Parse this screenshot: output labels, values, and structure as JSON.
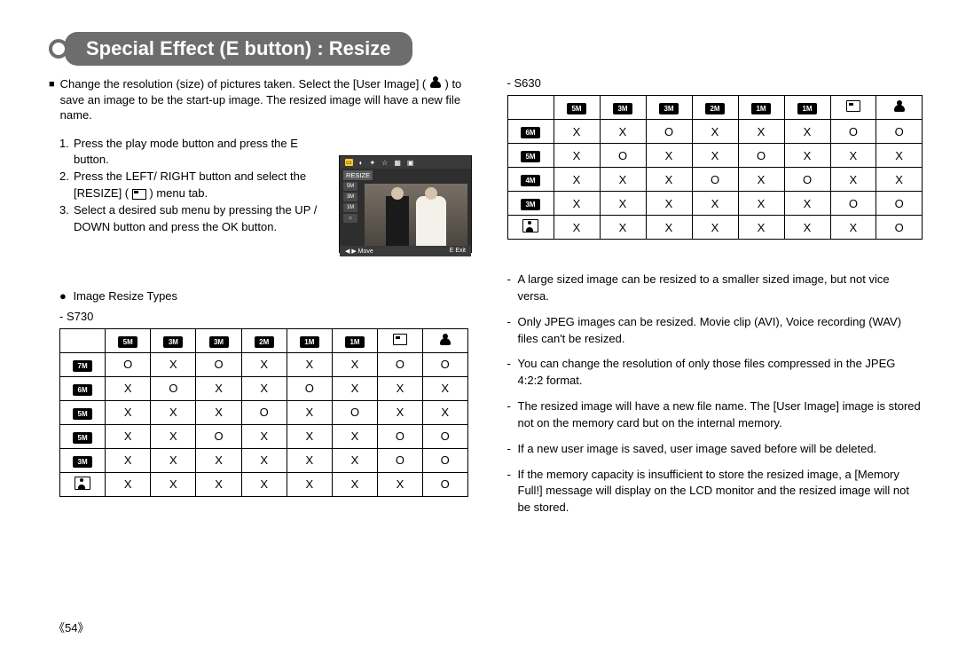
{
  "header": {
    "title": "Special Effect (E button) : Resize"
  },
  "intro": {
    "text_a": "Change the resolution (size) of pictures taken. Select the [User Image] (",
    "text_b": ") to save an image to be the start-up image. The resized image will have a new file name."
  },
  "steps": [
    {
      "n": "1.",
      "t": "Press the play mode button and press the E button."
    },
    {
      "n": "2.",
      "t_a": "Press the LEFT/ RIGHT button and select the [RESIZE] (",
      "t_b": ") menu tab."
    },
    {
      "n": "3.",
      "t": "Select a desired sub menu by pressing the UP / DOWN button and press the OK button."
    }
  ],
  "screenshot": {
    "label": "RESIZE",
    "side": [
      "5M",
      "3M",
      "1M",
      "⌂"
    ],
    "bottom_left": "◀ ▶ Move",
    "bottom_right": "E  Exit"
  },
  "subhead": "Image Resize Types",
  "s730": {
    "label": "- S730",
    "col_icons": [
      "5M",
      "3M",
      "3M",
      "2M",
      "1M",
      "1M",
      "outline",
      "user"
    ],
    "row_icons": [
      "7M",
      "6M",
      "5M",
      "5M",
      "3M",
      "userbox"
    ],
    "rows": [
      [
        "O",
        "X",
        "O",
        "X",
        "X",
        "X",
        "O",
        "O"
      ],
      [
        "X",
        "O",
        "X",
        "X",
        "O",
        "X",
        "X",
        "X"
      ],
      [
        "X",
        "X",
        "X",
        "O",
        "X",
        "O",
        "X",
        "X"
      ],
      [
        "X",
        "X",
        "O",
        "X",
        "X",
        "X",
        "O",
        "O"
      ],
      [
        "X",
        "X",
        "X",
        "X",
        "X",
        "X",
        "O",
        "O"
      ],
      [
        "X",
        "X",
        "X",
        "X",
        "X",
        "X",
        "X",
        "O"
      ]
    ]
  },
  "s630": {
    "label": "- S630",
    "col_icons": [
      "5M",
      "3M",
      "3M",
      "2M",
      "1M",
      "1M",
      "outline",
      "user"
    ],
    "row_icons": [
      "6M",
      "5M",
      "4M",
      "3M",
      "userbox"
    ],
    "rows": [
      [
        "X",
        "X",
        "O",
        "X",
        "X",
        "X",
        "O",
        "O"
      ],
      [
        "X",
        "O",
        "X",
        "X",
        "O",
        "X",
        "X",
        "X"
      ],
      [
        "X",
        "X",
        "X",
        "O",
        "X",
        "O",
        "X",
        "X"
      ],
      [
        "X",
        "X",
        "X",
        "X",
        "X",
        "X",
        "O",
        "O"
      ],
      [
        "X",
        "X",
        "X",
        "X",
        "X",
        "X",
        "X",
        "O"
      ]
    ]
  },
  "notes": [
    "A large sized image can be resized to a smaller sized image, but not vice versa.",
    "Only JPEG images can be resized. Movie clip (AVI), Voice recording (WAV) files can't be resized.",
    "You can change the resolution of only those files compressed in the JPEG 4:2:2 format.",
    "The resized image will have a new file name. The [User Image] image is stored not on the memory card but on the internal memory.",
    "If a new user image is saved, user image saved before will be deleted.",
    "If the memory capacity is insufficient to store the resized image, a [Memory Full!] message will display on the LCD monitor and the resized image will not be stored."
  ],
  "page_number": "《54》"
}
